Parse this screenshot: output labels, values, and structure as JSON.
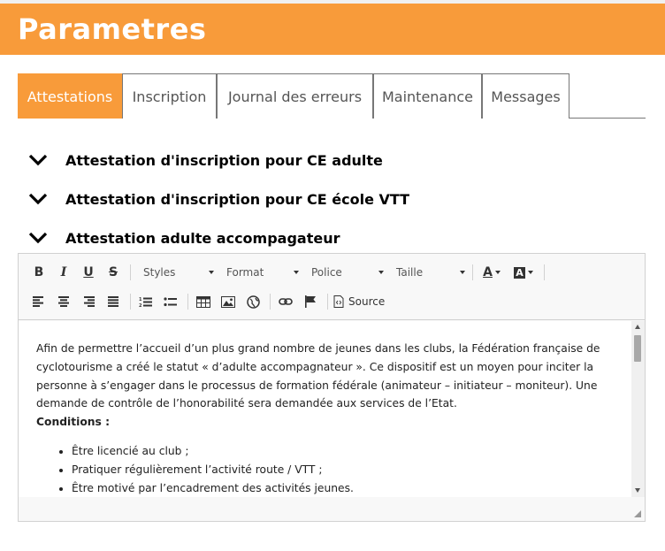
{
  "header": {
    "title": "Parametres"
  },
  "tabs": [
    {
      "label": "Attestations",
      "active": true
    },
    {
      "label": "Inscription",
      "active": false
    },
    {
      "label": "Journal des erreurs",
      "active": false
    },
    {
      "label": "Maintenance",
      "active": false
    },
    {
      "label": "Messages",
      "active": false
    }
  ],
  "accordion": [
    {
      "title": "Attestation d'inscription pour CE adulte",
      "icon": "chevron-down-icon"
    },
    {
      "title": "Attestation d'inscription pour CE école VTT",
      "icon": "chevron-down-icon"
    },
    {
      "title": "Attestation adulte accompagateur",
      "icon": "chevron-down-icon"
    }
  ],
  "toolbar": {
    "bold": "B",
    "italic": "I",
    "underline": "U",
    "strike": "S",
    "styles": "Styles",
    "format": "Format",
    "font": "Police",
    "size": "Taille",
    "text_color": "A",
    "bg_color": "A",
    "source": "Source"
  },
  "editor": {
    "paragraph": "Afin de permettre l’accueil d’un plus grand nombre de jeunes dans les clubs, la Fédération française de cyclotourisme a créé le statut « d’adulte accompagnateur ». Ce dispositif est un moyen pour inciter la personne à s’engager dans le processus de formation fédérale (animateur – initiateur – moniteur). Une demande de contrôle de l’honorabilité sera demandée aux services de l’Etat.",
    "conditions_label": "Conditions :",
    "conditions": [
      "Être licencié au club ;",
      "Pratiquer régulièrement l’activité route / VTT ;",
      "Être motivé par l’encadrement des activités jeunes."
    ]
  },
  "colors": {
    "accent": "#f89b3a",
    "tab_border": "#777777",
    "editor_bg": "#f8f8f8"
  }
}
